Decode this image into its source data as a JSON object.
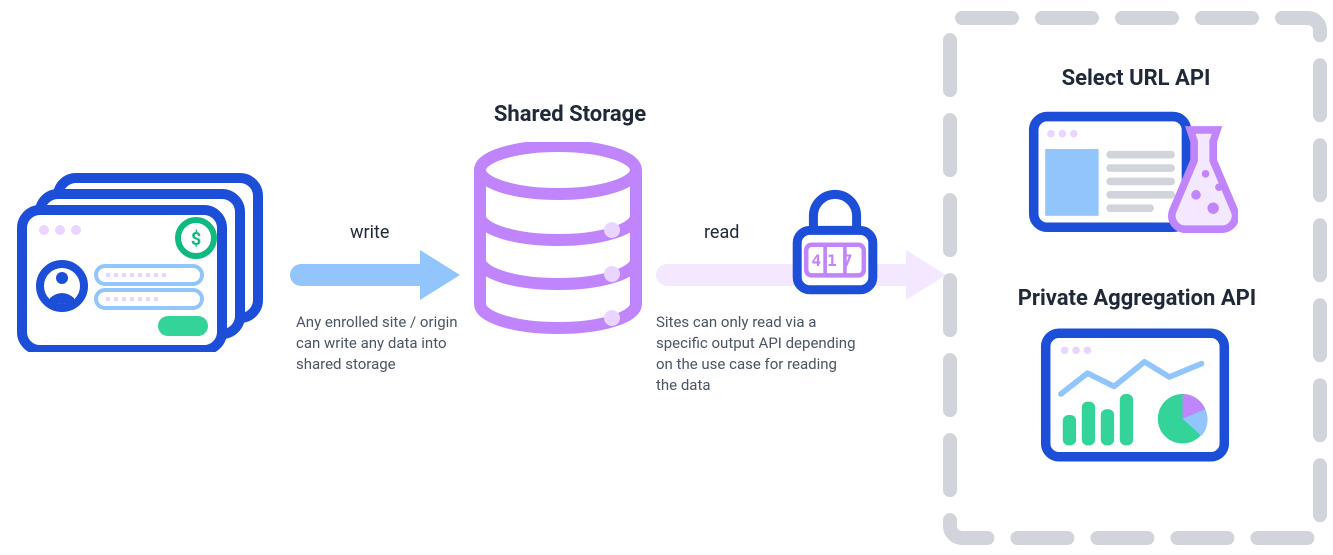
{
  "sharedStorage": {
    "title": "Shared Storage"
  },
  "write": {
    "label": "write",
    "description": "Any enrolled site / origin can write any data into shared storage"
  },
  "read": {
    "label": "read",
    "description": "Sites can only read via a specific output API depending on the use case for reading the data"
  },
  "lock": {
    "value": "417"
  },
  "selectUrl": {
    "title": "Select URL API"
  },
  "privateAggregation": {
    "title": "Private Aggregation API"
  }
}
